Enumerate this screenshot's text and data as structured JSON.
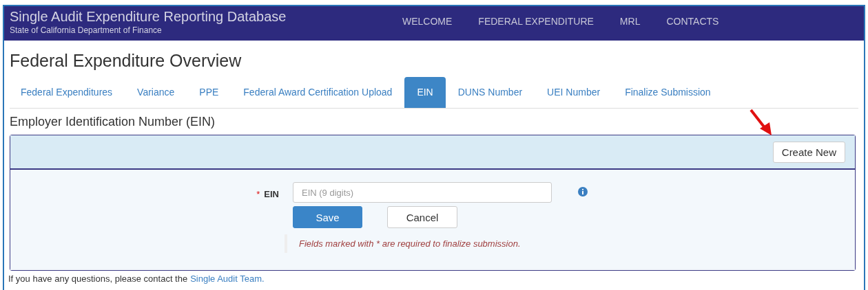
{
  "header": {
    "title": "Single Audit Expenditure Reporting Database",
    "subtitle": "State of California Department of Finance",
    "nav": [
      {
        "label": "WELCOME"
      },
      {
        "label": "FEDERAL EXPENDITURE"
      },
      {
        "label": "MRL"
      },
      {
        "label": "CONTACTS"
      }
    ]
  },
  "page_title": "Federal Expenditure Overview",
  "tabs": [
    {
      "label": "Federal Expenditures",
      "selected": false
    },
    {
      "label": "Variance",
      "selected": false
    },
    {
      "label": "PPE",
      "selected": false
    },
    {
      "label": "Federal Award Certification Upload",
      "selected": false
    },
    {
      "label": "EIN",
      "selected": true
    },
    {
      "label": "DUNS Number",
      "selected": false
    },
    {
      "label": "UEI Number",
      "selected": false
    },
    {
      "label": "Finalize Submission",
      "selected": false
    }
  ],
  "section_title": "Employer Identification Number (EIN)",
  "panel": {
    "create_button": "Create New",
    "form": {
      "required_mark": "*",
      "label": "EIN",
      "placeholder": "EIN (9 digits)",
      "save": "Save",
      "cancel": "Cancel",
      "hint": "Fields marked with * are required to finalize submission."
    }
  },
  "footer": {
    "text": "If you have any questions, please contact the",
    "link": "Single Audit Team."
  }
}
